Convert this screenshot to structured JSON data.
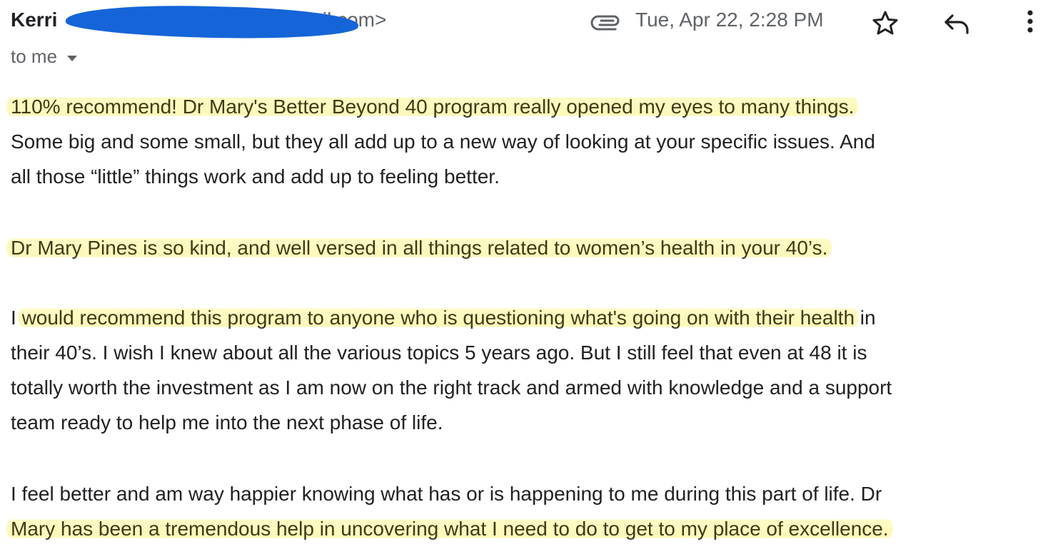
{
  "header": {
    "sender_name": "Kerri",
    "sender_email_visible": "s@gmail.com>",
    "date": "Tue, Apr 22, 2:28 PM",
    "icons": {
      "attachment": "paperclip-icon",
      "star": "star-icon",
      "reply": "reply-icon",
      "more": "more-vert-icon"
    }
  },
  "recipient": {
    "label": "to me"
  },
  "message": {
    "p1": {
      "line1": "110% recommend! Dr Mary's Better Beyond 40 program really opened my eyes to many things.",
      "line2": "Some big and some small, but they all add up to a new way of looking at your specific issues. And",
      "line3": "all those “little” things work and add up to feeling better."
    },
    "p2": {
      "line1": "Dr Mary Pines is so kind, and well versed in all things related to women’s health in your 40’s."
    },
    "p3": {
      "line1_pre": "I",
      "line1_hl": "would recommend this program to anyone who is questioning what's going on with their health",
      "line1_post": " in",
      "line2": "their 40’s. I wish I knew about all the various topics 5 years ago. But I still feel that even at 48 it is",
      "line3": "totally worth the investment as I am now on the right track and armed with knowledge and a support",
      "line4": "team ready to help me into the next phase of life."
    },
    "p4": {
      "line1": "I feel better and am way happier knowing what has or is happening to me during this part of life. Dr",
      "line2": "Mary has been a tremendous help in uncovering what I need to do to get to my place of excellence."
    }
  },
  "colors": {
    "highlight": "#fdf8b8",
    "redaction": "#1565d8",
    "text": "#202124",
    "secondary_text": "#5f6368"
  }
}
